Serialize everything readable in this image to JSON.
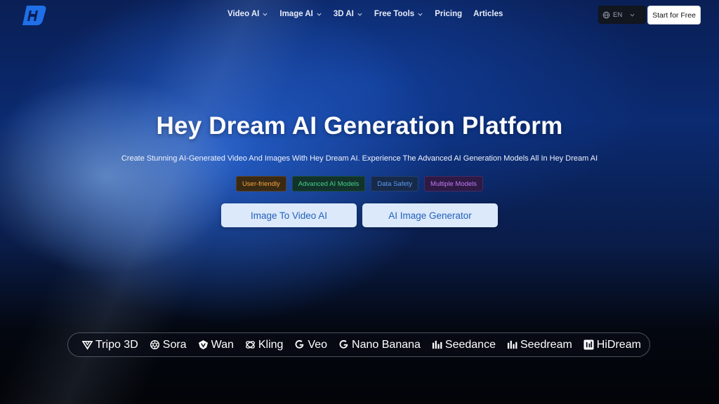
{
  "nav": {
    "menu": [
      {
        "label": "Video AI",
        "dropdown": true
      },
      {
        "label": "Image AI",
        "dropdown": true
      },
      {
        "label": "3D AI",
        "dropdown": true
      },
      {
        "label": "Free Tools",
        "dropdown": true
      },
      {
        "label": "Pricing",
        "dropdown": false
      },
      {
        "label": "Articles",
        "dropdown": false
      }
    ],
    "language": "EN",
    "start_label": "Start for Free"
  },
  "hero": {
    "title": "Hey Dream AI Generation Platform",
    "subtitle": "Create Stunning AI-Generated Video And Images With Hey Dream AI. Experience The Advanced AI Generation Models All In Hey Dream AI",
    "tags": [
      "User-friendly",
      "Advanced AI Models",
      "Data Safety",
      "Multiple Models"
    ],
    "buttons": [
      "Image To Video AI",
      "AI Image Generator"
    ]
  },
  "models": [
    {
      "label": "Tripo 3D",
      "icon": "tripo-icon"
    },
    {
      "label": "Sora",
      "icon": "openai-icon"
    },
    {
      "label": "Wan",
      "icon": "wan-icon"
    },
    {
      "label": "Kling",
      "icon": "kling-icon"
    },
    {
      "label": "Veo",
      "icon": "google-icon"
    },
    {
      "label": "Nano Banana",
      "icon": "google-icon"
    },
    {
      "label": "Seedance",
      "icon": "bytedance-icon"
    },
    {
      "label": "Seedream",
      "icon": "bytedance-icon"
    },
    {
      "label": "HiDream",
      "icon": "hidream-icon"
    }
  ],
  "colors": {
    "accent": "#2460b8",
    "cta_bg": "#dbe9fb",
    "logo": "#1e6fe8"
  }
}
